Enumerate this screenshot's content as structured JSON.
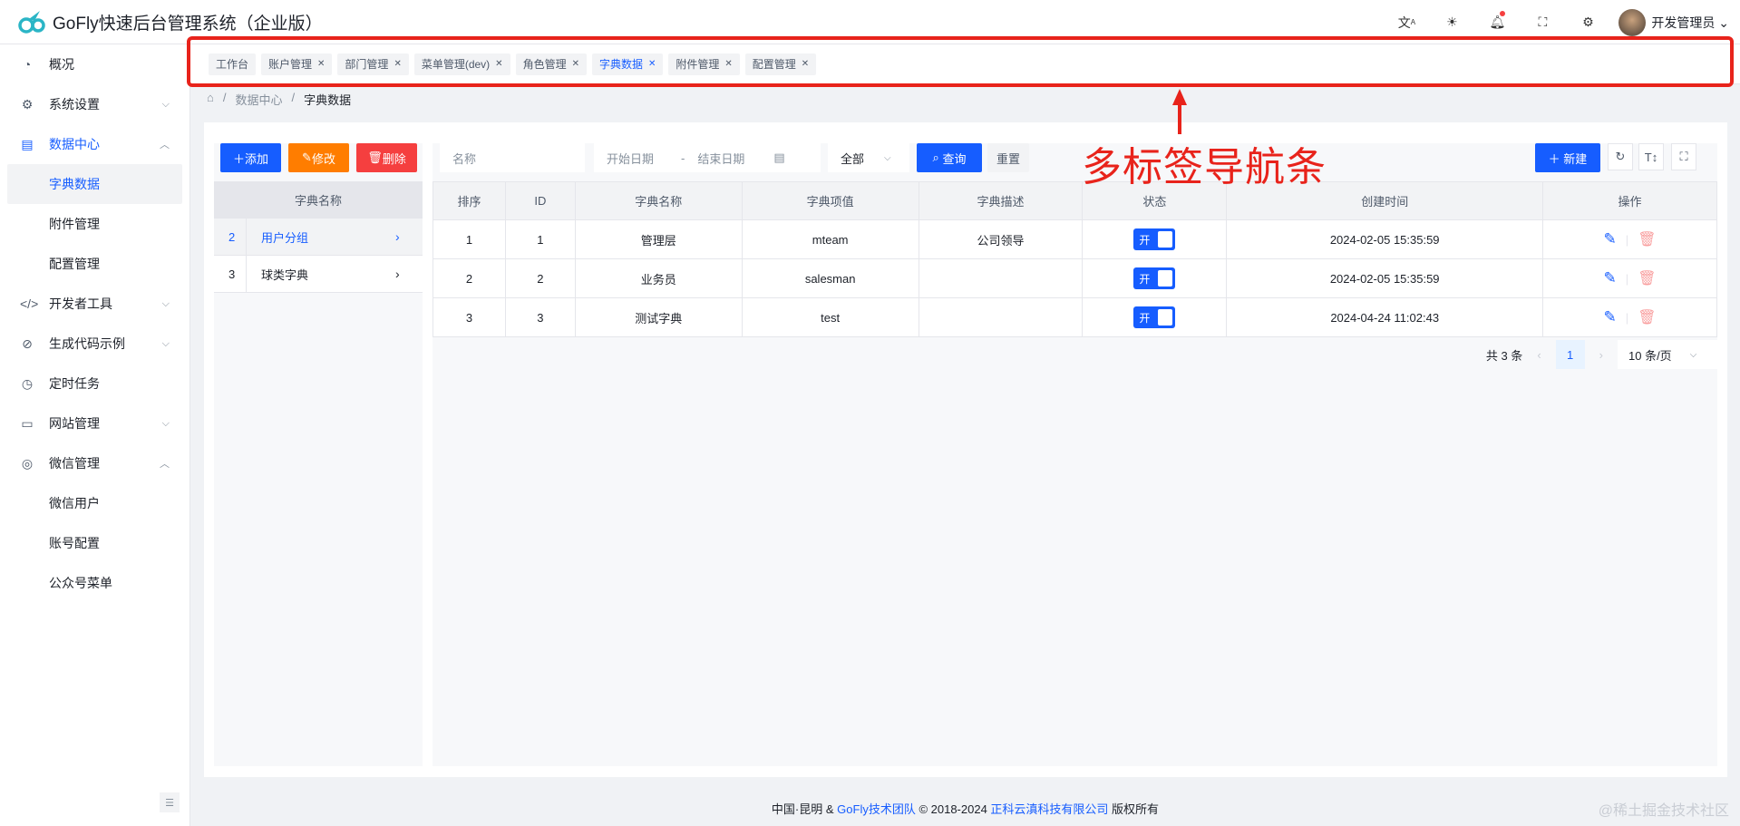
{
  "header": {
    "title": "GoFly快速后台管理系统（企业版）",
    "user": "开发管理员",
    "icons": [
      "translate-icon",
      "theme-sun-icon",
      "bell-icon",
      "fullscreen-icon",
      "settings-icon"
    ]
  },
  "sidebar": {
    "items": [
      {
        "label": "概况",
        "icon": "dashboard-icon"
      },
      {
        "label": "系统设置",
        "icon": "gear-icon"
      },
      {
        "label": "数据中心",
        "icon": "table-icon"
      },
      {
        "label": "字典数据"
      },
      {
        "label": "附件管理"
      },
      {
        "label": "配置管理"
      },
      {
        "label": "开发者工具",
        "icon": "code-icon"
      },
      {
        "label": "生成代码示例",
        "icon": "compass-icon"
      },
      {
        "label": "定时任务",
        "icon": "clock-icon"
      },
      {
        "label": "网站管理",
        "icon": "monitor-icon"
      },
      {
        "label": "微信管理",
        "icon": "wechat-icon"
      },
      {
        "label": "微信用户"
      },
      {
        "label": "账号配置"
      },
      {
        "label": "公众号菜单"
      }
    ]
  },
  "tabs": [
    "工作台",
    "账户管理",
    "部门管理",
    "菜单管理(dev)",
    "角色管理",
    "字典数据",
    "附件管理",
    "配置管理"
  ],
  "annotation": "多标签导航条",
  "breadcrumb": [
    "数据中心",
    "字典数据"
  ],
  "left": {
    "add": "添加",
    "edit": "修改",
    "delete": "删除",
    "header": "字典名称",
    "rows": [
      {
        "id": "2",
        "name": "用户分组"
      },
      {
        "id": "3",
        "name": "球类字典"
      }
    ]
  },
  "filters": {
    "name_placeholder": "名称",
    "start": "开始日期",
    "sep": "-",
    "end": "结束日期",
    "status": "全部",
    "search": "查询",
    "reset": "重置",
    "new": "新建"
  },
  "table": {
    "columns": [
      "排序",
      "ID",
      "字典名称",
      "字典项值",
      "字典描述",
      "状态",
      "创建时间",
      "操作"
    ],
    "rows": [
      {
        "sort": "1",
        "id": "1",
        "name": "管理层",
        "value": "mteam",
        "desc": "公司领导",
        "status": "开",
        "created": "2024-02-05 15:35:59"
      },
      {
        "sort": "2",
        "id": "2",
        "name": "业务员",
        "value": "salesman",
        "desc": "",
        "status": "开",
        "created": "2024-02-05 15:35:59"
      },
      {
        "sort": "3",
        "id": "3",
        "name": "测试字典",
        "value": "test",
        "desc": "",
        "status": "开",
        "created": "2024-04-24 11:02:43"
      }
    ]
  },
  "pager": {
    "total": "共 3 条",
    "page": "1",
    "size": "10 条/页"
  },
  "footer": {
    "a": "中国·昆明 & ",
    "b": "GoFly技术团队",
    "c": " © 2018-2024 ",
    "d": "正科云滇科技有限公司",
    "e": " 版权所有"
  },
  "watermark": "@稀土掘金技术社区"
}
